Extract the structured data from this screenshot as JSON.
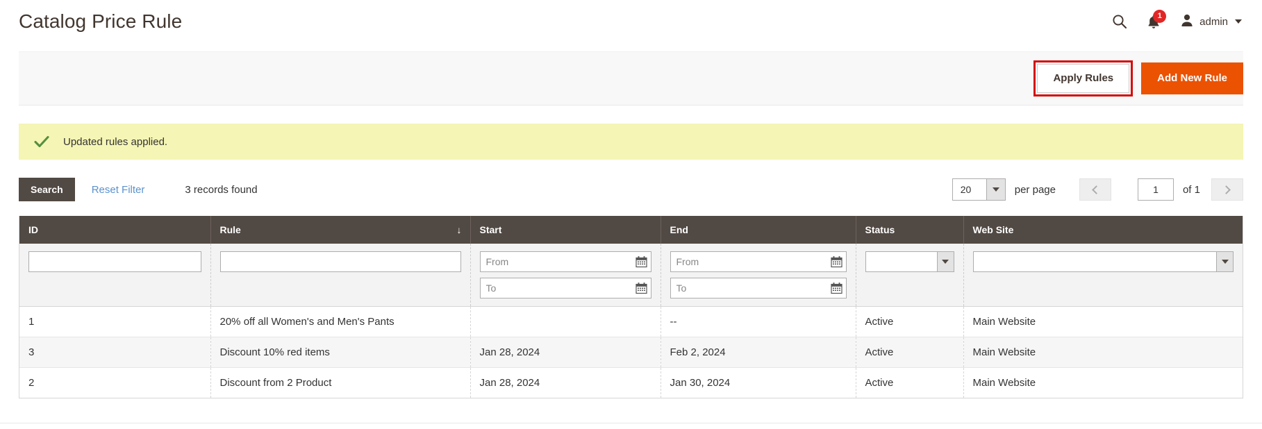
{
  "header": {
    "title": "Catalog Price Rule",
    "search_icon": "search-icon",
    "bell_icon": "notification-bell-icon",
    "notification_count": "1",
    "avatar_icon": "user-avatar-icon",
    "admin_label": "admin"
  },
  "toolbar": {
    "apply_rules_label": "Apply Rules",
    "add_new_rule_label": "Add New Rule",
    "highlight_color": "#d40b0b",
    "primary_color": "#eb5202"
  },
  "message": {
    "icon": "check-icon",
    "text": "Updated rules applied.",
    "background_color": "#f5f5b5",
    "icon_color": "#568f3f"
  },
  "grid_controls": {
    "search_label": "Search",
    "reset_filter_label": "Reset Filter",
    "records_found": "3 records found",
    "per_page_value": "20",
    "per_page_label": "per page",
    "page_value": "1",
    "of_total": "of 1",
    "prev_icon": "chevron-left-icon",
    "next_icon": "chevron-right-icon"
  },
  "grid": {
    "columns": [
      {
        "label": "ID",
        "sorted": false
      },
      {
        "label": "Rule",
        "sorted": true,
        "sort_indicator": "↓"
      },
      {
        "label": "Start",
        "sorted": false
      },
      {
        "label": "End",
        "sorted": false
      },
      {
        "label": "Status",
        "sorted": false
      },
      {
        "label": "Web Site",
        "sorted": false
      }
    ],
    "filters": {
      "id_value": "",
      "rule_value": "",
      "start_from_placeholder": "From",
      "start_to_placeholder": "To",
      "end_from_placeholder": "From",
      "end_to_placeholder": "To",
      "start_from_value": "",
      "start_to_value": "",
      "end_from_value": "",
      "end_to_value": "",
      "status_value": "",
      "website_value": "",
      "calendar_icon": "calendar-icon"
    },
    "rows": [
      {
        "id": "1",
        "rule": "20% off all Women's and Men's Pants",
        "start": "",
        "end": "--",
        "status": "Active",
        "website": "Main Website"
      },
      {
        "id": "3",
        "rule": "Discount 10% red items",
        "start": "Jan 28, 2024",
        "end": "Feb 2, 2024",
        "status": "Active",
        "website": "Main Website"
      },
      {
        "id": "2",
        "rule": "Discount from 2 Product",
        "start": "Jan 28, 2024",
        "end": "Jan 30, 2024",
        "status": "Active",
        "website": "Main Website"
      }
    ]
  }
}
